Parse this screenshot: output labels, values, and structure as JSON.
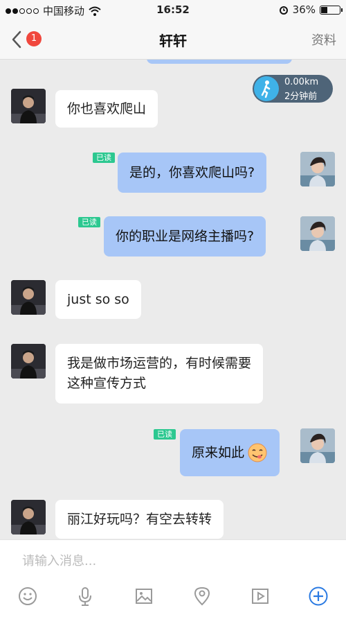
{
  "status_bar": {
    "carrier": "中国移动",
    "time": "16:52",
    "battery": "36%"
  },
  "nav": {
    "unread_count": "1",
    "title": "轩轩",
    "profile_label": "资料"
  },
  "walk_card": {
    "distance": "0.00km",
    "time_ago": "2分钟前"
  },
  "read_label": "已读",
  "messages": [
    {
      "from": "other",
      "text": "你也喜欢爬山"
    },
    {
      "from": "self",
      "text": "是的，你喜欢爬山吗?"
    },
    {
      "from": "self",
      "text": "你的职业是网络主播吗?"
    },
    {
      "from": "other",
      "text": "just so so"
    },
    {
      "from": "other",
      "line1": "我是做市场运营的，有时候需要",
      "line2": "这种宣传方式"
    },
    {
      "from": "self",
      "text": "原来如此"
    },
    {
      "from": "other",
      "text": "丽江好玩吗？有空去转转"
    }
  ],
  "input": {
    "placeholder": "请输入消息..."
  },
  "toolbar_icons": [
    "emoji-icon",
    "microphone-icon",
    "image-icon",
    "location-icon",
    "video-icon",
    "add-icon"
  ],
  "colors": {
    "incoming_bubble": "#ffffff",
    "outgoing_bubble": "#a7c6f7",
    "read_badge": "#2cc890",
    "unread_badge": "#f0473d",
    "accent": "#2a7ae2"
  }
}
